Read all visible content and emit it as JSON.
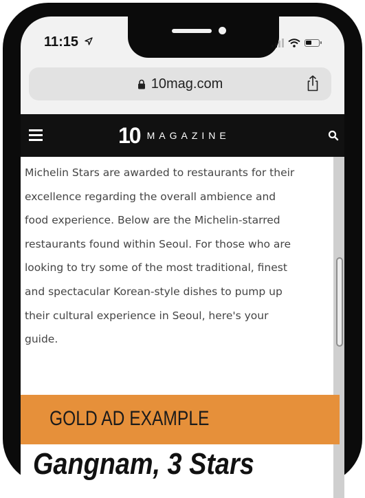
{
  "status_bar": {
    "time": "11:15",
    "location_icon": "location-arrow-icon",
    "signal_icon": "cellular-signal-icon",
    "wifi_icon": "wifi-icon",
    "battery_icon": "battery-icon"
  },
  "browser": {
    "url": "10mag.com",
    "lock_icon": "lock-icon",
    "share_icon": "share-icon"
  },
  "site_header": {
    "logo_mark": "10",
    "logo_word": "MAGAZINE",
    "menu_icon": "hamburger-menu-icon",
    "search_icon": "search-icon",
    "background": "#111111"
  },
  "article": {
    "lines": [
      "Michelin Stars are awarded to restaurants for their",
      "excellence regarding the overall ambience and",
      "food experience. Below are the Michelin-starred",
      "restaurants found within Seoul. For those who are",
      "looking to try some of the most traditional, finest",
      "and spectacular Korean-style dishes to pump up",
      "their cultural experience in Seoul, here's your",
      "guide."
    ]
  },
  "ad": {
    "label": "GOLD AD EXAMPLE",
    "color": "#e6903a"
  },
  "section": {
    "heading": "Gangnam, 3 Stars"
  }
}
